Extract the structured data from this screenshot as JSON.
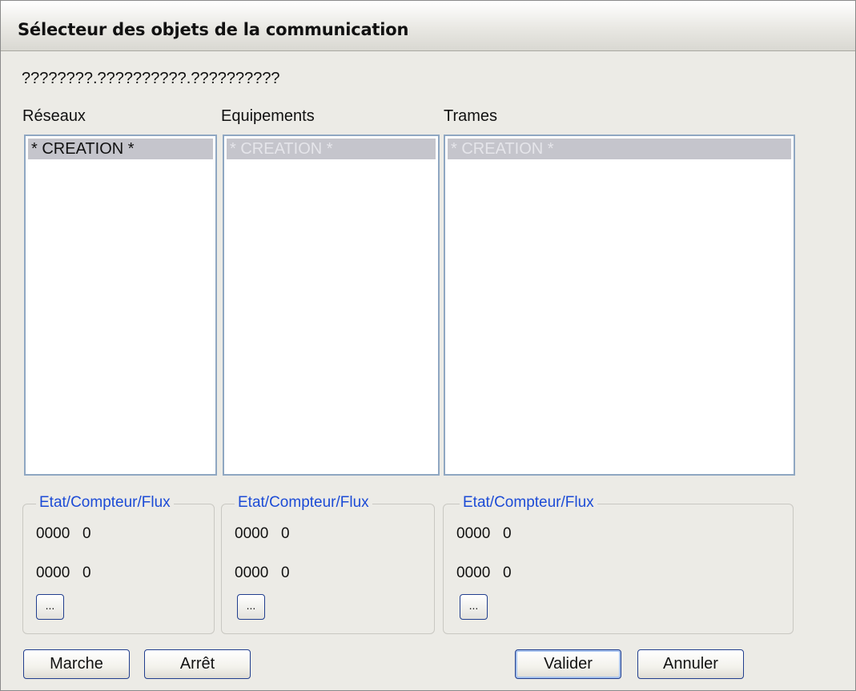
{
  "window": {
    "title": "Sélecteur des objets de la communication"
  },
  "path": "????????.??????????.??????????",
  "columns": [
    {
      "label": "Réseaux",
      "items": [
        "* CREATION *"
      ],
      "group": {
        "legend": "Etat/Compteur/Flux",
        "row1": {
          "code": "0000",
          "value": "0"
        },
        "row2": {
          "code": "0000",
          "value": "0"
        },
        "button_label": "..."
      }
    },
    {
      "label": "Equipements",
      "items": [
        "* CREATION *"
      ],
      "group": {
        "legend": "Etat/Compteur/Flux",
        "row1": {
          "code": "0000",
          "value": "0"
        },
        "row2": {
          "code": "0000",
          "value": "0"
        },
        "button_label": "..."
      }
    },
    {
      "label": "Trames",
      "items": [
        "* CREATION *"
      ],
      "group": {
        "legend": "Etat/Compteur/Flux",
        "row1": {
          "code": "0000",
          "value": "0"
        },
        "row2": {
          "code": "0000",
          "value": "0"
        },
        "button_label": "..."
      }
    }
  ],
  "buttons": {
    "marche": "Marche",
    "arret": "Arrêt",
    "valider": "Valider",
    "annuler": "Annuler"
  },
  "colors": {
    "legend": "#1c4bd6",
    "selection": "#c5c5cc",
    "list_border": "#8fa7c2"
  }
}
